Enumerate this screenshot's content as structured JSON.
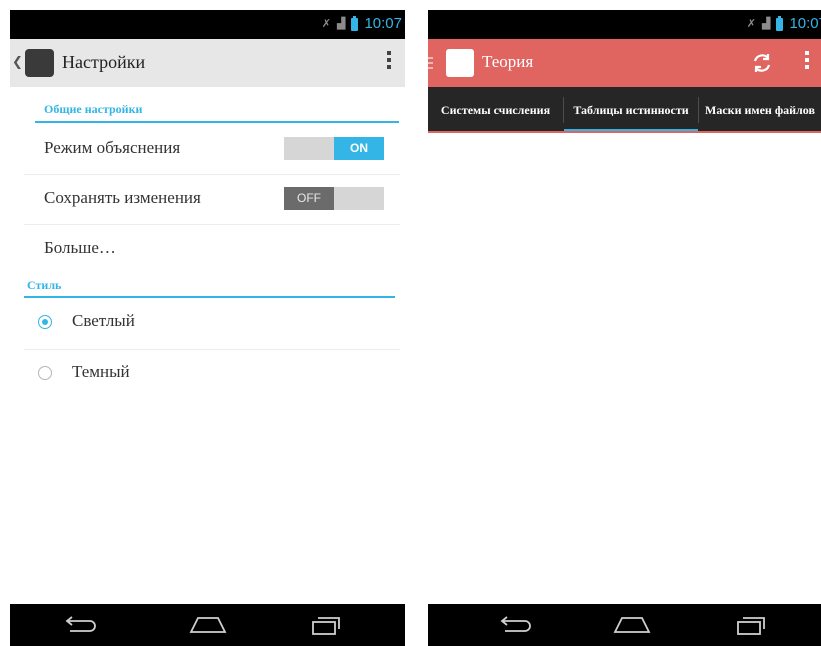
{
  "status_bar": {
    "time": "10:07"
  },
  "settings_screen": {
    "action_bar": {
      "title": "Настройки"
    },
    "sections": [
      {
        "header": "Общие настройки"
      },
      {
        "header": "Стиль"
      }
    ],
    "switch_prefs": [
      {
        "label": "Режим объяснения",
        "state": "ON"
      },
      {
        "label": "Сохранять изменения",
        "state": "OFF"
      }
    ],
    "more_item": {
      "label": "Больше…"
    },
    "radio_options": [
      {
        "label": "Светлый",
        "checked": true
      },
      {
        "label": "Темный",
        "checked": false
      }
    ],
    "colors": {
      "accent": "#33b5e5",
      "action_bar_bg": "#e7e7e7"
    }
  },
  "theory_screen": {
    "action_bar": {
      "title": "Теория"
    },
    "tabs": [
      {
        "label": "Системы счисления",
        "selected": false
      },
      {
        "label": "Таблицы истинности",
        "selected": true
      },
      {
        "label": "Маски имен файлов",
        "selected": false
      }
    ],
    "colors": {
      "action_bar_bg": "#e06560",
      "tab_bar_bg": "#262626",
      "indicator": "#33b5e5"
    }
  },
  "icons": {
    "nav_bar": [
      "back-icon",
      "home-icon",
      "recent-apps-icon"
    ],
    "status_bar": [
      "wifi-off-icon",
      "signal-icon",
      "battery-icon"
    ],
    "action_bar": [
      "refresh-icon",
      "overflow-menu-icon",
      "drawer-icon"
    ]
  }
}
